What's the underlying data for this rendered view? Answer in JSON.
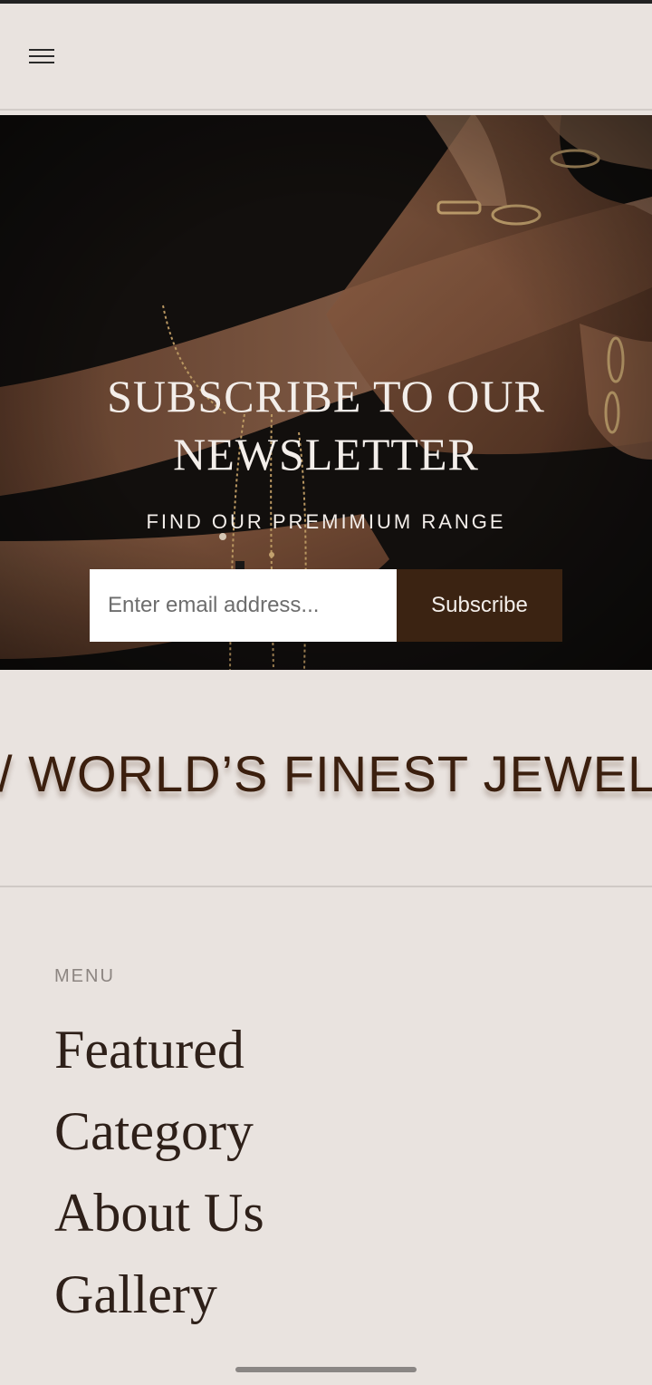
{
  "header": {
    "menu_icon": "hamburger-menu-icon"
  },
  "hero": {
    "background": "hands-with-gold-rings-and-bracelets-photo",
    "title": "SUBSCRIBE TO OUR NEWSLETTER",
    "subtitle": "FIND OUR PREMIMIUM RANGE",
    "email_placeholder": "Enter email address...",
    "subscribe_label": "Subscribe"
  },
  "marquee": {
    "text": "/ WORLD’S FINEST JEWELL"
  },
  "menu": {
    "heading": "MENU",
    "items": [
      {
        "label": "Featured"
      },
      {
        "label": "Category"
      },
      {
        "label": "About Us"
      },
      {
        "label": "Gallery"
      }
    ]
  },
  "colors": {
    "background": "#e9e3df",
    "accent": "#3b2312",
    "marquee_text": "#3b1f0e",
    "menu_text": "#2e2019",
    "muted_text": "#8c8581"
  }
}
